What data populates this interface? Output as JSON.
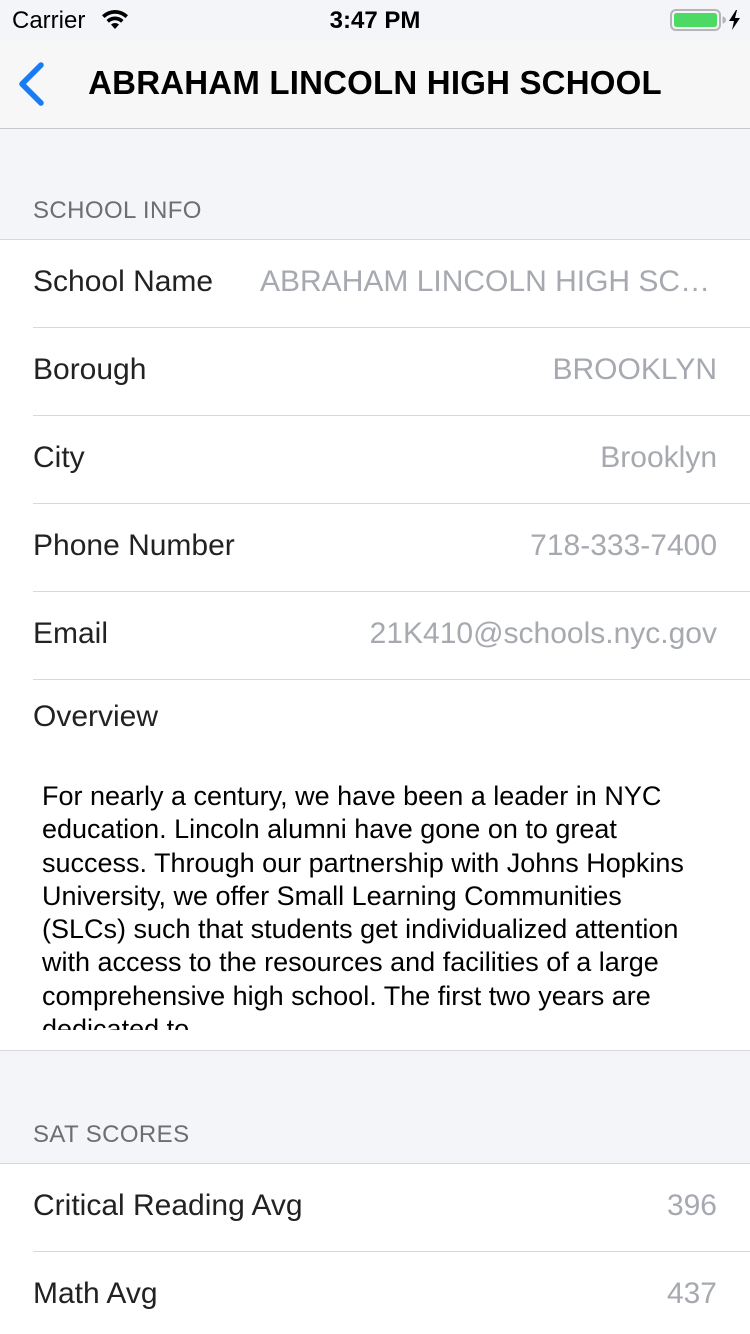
{
  "status_bar": {
    "carrier": "Carrier",
    "time": "3:47 PM",
    "wifi_icon": "wifi-icon",
    "battery_icon": "battery-charging-icon",
    "battery_color": "#4cd964"
  },
  "nav": {
    "title": "ABRAHAM LINCOLN HIGH SCHOOL",
    "back_icon": "chevron-left-icon",
    "accent": "#1a7cf5"
  },
  "school_info": {
    "header": "SCHOOL INFO",
    "rows": [
      {
        "label": "School Name",
        "value": "ABRAHAM LINCOLN HIGH SCHOOL"
      },
      {
        "label": "Borough",
        "value": "BROOKLYN"
      },
      {
        "label": "City",
        "value": "Brooklyn"
      },
      {
        "label": "Phone Number",
        "value": "718-333-7400"
      },
      {
        "label": "Email",
        "value": "21K410@schools.nyc.gov"
      }
    ],
    "overview_label": "Overview",
    "overview_text": "For nearly a century, we have been a leader in NYC education. Lincoln alumni have gone on to great success. Through our partnership with Johns Hopkins University, we offer Small Learning Communities (SLCs) such that students get individualized attention with access to the resources and facilities of a large comprehensive high school. The first two years are dedicated to"
  },
  "sat_scores": {
    "header": "SAT SCORES",
    "rows": [
      {
        "label": "Critical Reading Avg",
        "value": "396"
      },
      {
        "label": "Math Avg",
        "value": "437"
      }
    ]
  }
}
